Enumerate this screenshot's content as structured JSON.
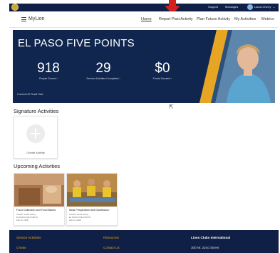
{
  "utility": {
    "support": "Support",
    "messages": "Messages",
    "user": "Laura Cherry"
  },
  "nav": {
    "brand": "MyLion",
    "links": [
      "Home",
      "Report Past Activity",
      "Plan Future Activity",
      "My Activities",
      "Metrics"
    ]
  },
  "hero": {
    "title": "EL PASO FIVE POINTS",
    "stats": [
      {
        "value": "918",
        "label": "People Served"
      },
      {
        "value": "29",
        "label": "Service Activities Completed"
      },
      {
        "value": "$0",
        "label": "Funds Donated"
      }
    ],
    "fiscal": "Current US Fiscal Year"
  },
  "signature": {
    "heading": "Signature Activities",
    "create_label": "Create Activity"
  },
  "upcoming": {
    "heading": "Upcoming Activities",
    "events": [
      {
        "title": "Food Collection and Food Banks",
        "meta": [
          "Creator: Laura Cherry",
          "EL PASO FIVE POINTS",
          "Feb 12, 2018"
        ]
      },
      {
        "title": "Meal Preparation and Distribution",
        "meta": [
          "Creator: Laura Cherry",
          "EL PASO FIVE POINTS",
          "Feb 14, 2018"
        ]
      }
    ]
  },
  "footer": {
    "col1": [
      "Service Activities",
      "Create"
    ],
    "col2": [
      "Resources",
      "Contact Us"
    ],
    "col3": [
      "Lions Clubs International",
      "300 W. 22nd Street"
    ]
  },
  "colors": {
    "navy": "#10264f",
    "footer": "#0f1f45",
    "accent": "#e2a21b",
    "marker": "#d51f1f"
  }
}
